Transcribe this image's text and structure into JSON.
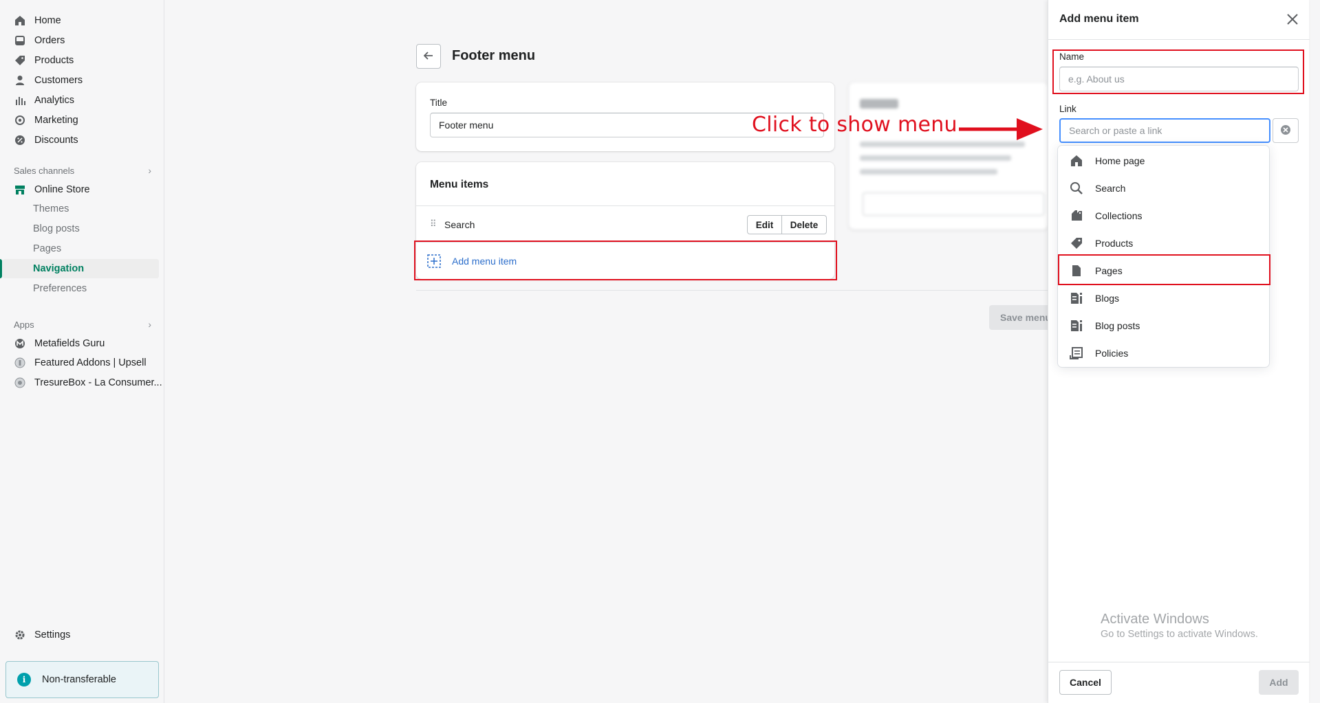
{
  "sidebar": {
    "items": [
      {
        "label": "Home",
        "icon": "home-icon"
      },
      {
        "label": "Orders",
        "icon": "orders-icon"
      },
      {
        "label": "Products",
        "icon": "tag-icon"
      },
      {
        "label": "Customers",
        "icon": "person-icon"
      },
      {
        "label": "Analytics",
        "icon": "bar-chart-icon"
      },
      {
        "label": "Marketing",
        "icon": "target-icon"
      },
      {
        "label": "Discounts",
        "icon": "discount-icon"
      }
    ],
    "sales_channels_label": "Sales channels",
    "online_store": "Online Store",
    "store_subitems": [
      "Themes",
      "Blog posts",
      "Pages",
      "Navigation",
      "Preferences"
    ],
    "apps_label": "Apps",
    "apps": [
      "Metafields Guru",
      "Featured Addons | Upsell",
      "TresureBox - La Consumer..."
    ],
    "settings": "Settings",
    "banner": "Non-transferable",
    "accent": "#008060"
  },
  "main": {
    "page_title": "Footer menu",
    "title_label": "Title",
    "title_value": "Footer menu",
    "menu_items_heading": "Menu items",
    "menu_item": "Search",
    "edit": "Edit",
    "delete": "Delete",
    "add_menu_item": "Add menu item",
    "save_menu": "Save menu"
  },
  "annotation": "Click to show menu",
  "drawer": {
    "title": "Add menu item",
    "name_label": "Name",
    "name_placeholder": "e.g. About us",
    "link_label": "Link",
    "link_placeholder": "Search or paste a link",
    "options": [
      {
        "label": "Home page",
        "icon": "home-icon"
      },
      {
        "label": "Search",
        "icon": "search-icon"
      },
      {
        "label": "Collections",
        "icon": "collections-icon"
      },
      {
        "label": "Products",
        "icon": "tag-icon"
      },
      {
        "label": "Pages",
        "icon": "page-icon"
      },
      {
        "label": "Blogs",
        "icon": "blog-icon"
      },
      {
        "label": "Blog posts",
        "icon": "blog-post-icon"
      },
      {
        "label": "Policies",
        "icon": "policy-icon"
      }
    ],
    "cancel": "Cancel",
    "add": "Add"
  },
  "watermark": {
    "line1": "Activate Windows",
    "line2": "Go to Settings to activate Windows."
  },
  "colors": {
    "highlight": "#e0101e",
    "link": "#2c6ecb"
  }
}
